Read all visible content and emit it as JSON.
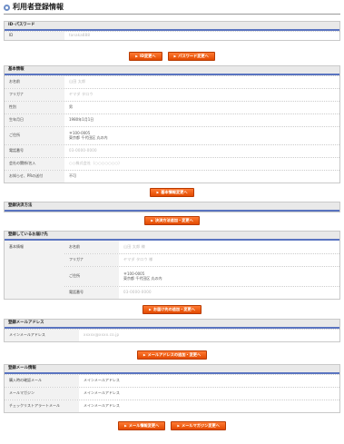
{
  "title": "利用者登録情報",
  "id_section": {
    "heading": "ID･パスワード",
    "rows": [
      {
        "label": "ID",
        "value": "tanaka888"
      }
    ],
    "buttons": {
      "id_change": "ID変更へ",
      "password_change": "パスワード変更へ"
    }
  },
  "basic_section": {
    "heading": "基本情報",
    "rows": [
      {
        "label": "お名前",
        "value": "山田 太郎"
      },
      {
        "label": "フリガナ",
        "value": "ヤマダ タロウ"
      },
      {
        "label": "性別",
        "value": "男"
      },
      {
        "label": "生年月日",
        "value": "1980年1月1日"
      },
      {
        "label": "ご住所",
        "line1": "〒100-0005",
        "line2": "東京都 千代田区 丸の内"
      },
      {
        "label": "電話番号",
        "value": "03-0000-0000"
      },
      {
        "label": "会社の関係/名入",
        "value": "○○株式会社（○○○○○○○）"
      },
      {
        "label": "お知らせ、PRの送付",
        "value": "不可"
      }
    ],
    "button": "基本情報変更へ"
  },
  "payment_section": {
    "heading": "登録決済方法",
    "button": "決済方法追加・変更へ"
  },
  "delivery_section": {
    "heading": "登録しているお届け先",
    "outer_label": "基本情報",
    "rows": [
      {
        "label": "お名前",
        "value": "山田 太郎 様"
      },
      {
        "label": "フリガナ",
        "value": "ヤマダ タロウ 様"
      },
      {
        "label": "ご住所",
        "line1": "〒100-0005",
        "line2": "東京都 千代田区 丸の内"
      },
      {
        "label": "電話番号",
        "value": "03-0000-0000"
      }
    ],
    "button": "お届け先の追加・変更へ"
  },
  "mail_section": {
    "heading": "登録メールアドレス",
    "rows": [
      {
        "label": "メインメールアドレス",
        "value": "xxxxx@xxxx.co.jp"
      }
    ],
    "button": "メールアドレスの追加・変更へ"
  },
  "mailinfo_section": {
    "heading": "登録メール情報",
    "rows": [
      {
        "label": "購入時の確認メール",
        "value": "メインメールアドレス"
      },
      {
        "label": "メールマガジン",
        "value": "メインメールアドレス"
      },
      {
        "label": "チェックリストアラートメール",
        "value": "メインメールアドレス"
      }
    ],
    "buttons": {
      "mail_info_change": "メール情報変更へ",
      "magazine_change": "メールマガジン変更へ"
    }
  },
  "colors": {
    "button": "#e85a10",
    "header_rule": "#5a74c0",
    "label_bg": "#f2f2f2"
  },
  "icons": {
    "title": "circle-icon",
    "button_arrow": "triangle-right-icon"
  }
}
